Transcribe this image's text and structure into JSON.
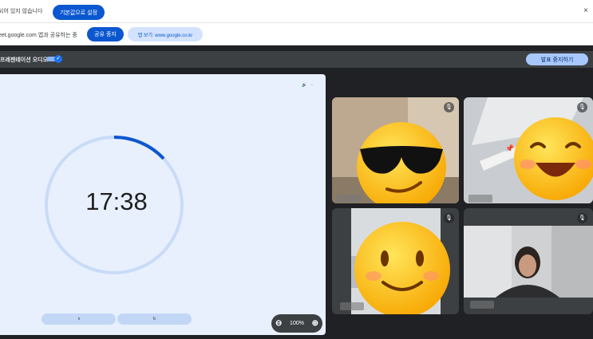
{
  "notification": {
    "message": "되어 있지 않습니다",
    "set_default_label": "기본값으로 설정",
    "close_glyph": "×"
  },
  "sharing": {
    "message": "eet.google.com 앱과 공유하는 중",
    "stop_label": "공유 중지",
    "view_tab_label": "탭 보기: www.google.co.kr"
  },
  "presenter": {
    "audio_label": "프레젠테이션 오디오",
    "toggle_on": true,
    "stop_presenting_label": "발표 중지하기"
  },
  "screen": {
    "timer": "17:38",
    "progress": 0.13,
    "controls": [
      "॥",
      "↻"
    ],
    "top_icons": [
      "speaker-icon",
      "window-icon"
    ],
    "accent_color": "#0b57d0",
    "ring_color": "#c9dbf7"
  },
  "zoom": {
    "value": "100%"
  },
  "participants": [
    {
      "emoji": "😎",
      "muted": true
    },
    {
      "emoji": "😆",
      "muted": true,
      "pinned": true
    },
    {
      "emoji": "🙂",
      "muted": true
    },
    {
      "emoji": "",
      "muted": true
    }
  ]
}
